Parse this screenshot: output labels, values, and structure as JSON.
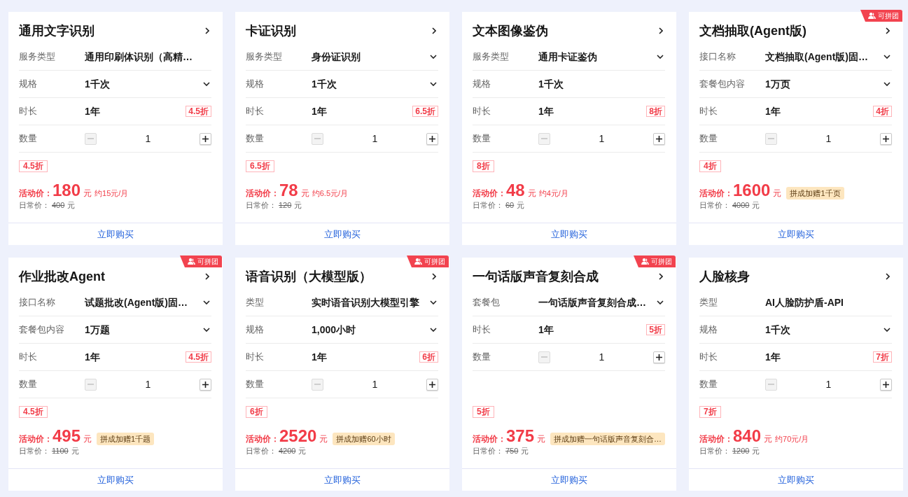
{
  "cards": [
    {
      "title": "通用文字识别",
      "options": [
        {
          "kind": "text",
          "label": "服务类型",
          "value": "通用印刷体识别（高精…"
        },
        {
          "kind": "select",
          "label": "规格",
          "value": "1千次"
        },
        {
          "kind": "duration",
          "label": "时长",
          "value": "1年",
          "discount": "4.5折"
        },
        {
          "kind": "quantity",
          "label": "数量",
          "value": "1",
          "minus_disabled": true
        }
      ],
      "discount": "4.5折",
      "sale_label": "活动价：",
      "price": "180",
      "price_unit": "元",
      "note": {
        "kind": "monthly",
        "text": "约15元/月"
      },
      "regular_label": "日常价：",
      "regular_price": "400",
      "regular_unit": "元",
      "buy": "立即购买"
    },
    {
      "title": "卡证识别",
      "options": [
        {
          "kind": "select",
          "label": "服务类型",
          "value": "身份证识别"
        },
        {
          "kind": "select",
          "label": "规格",
          "value": "1千次"
        },
        {
          "kind": "duration",
          "label": "时长",
          "value": "1年",
          "discount": "6.5折"
        },
        {
          "kind": "quantity",
          "label": "数量",
          "value": "1",
          "minus_disabled": true
        }
      ],
      "discount": "6.5折",
      "sale_label": "活动价：",
      "price": "78",
      "price_unit": "元",
      "note": {
        "kind": "monthly",
        "text": "约6.5元/月"
      },
      "regular_label": "日常价：",
      "regular_price": "120",
      "regular_unit": "元",
      "buy": "立即购买"
    },
    {
      "title": "文本图像鉴伪",
      "options": [
        {
          "kind": "select",
          "label": "服务类型",
          "value": "通用卡证鉴伪"
        },
        {
          "kind": "text",
          "label": "规格",
          "value": "1千次"
        },
        {
          "kind": "duration",
          "label": "时长",
          "value": "1年",
          "discount": "8折"
        },
        {
          "kind": "quantity",
          "label": "数量",
          "value": "1",
          "minus_disabled": true
        }
      ],
      "discount": "8折",
      "sale_label": "活动价：",
      "price": "48",
      "price_unit": "元",
      "note": {
        "kind": "monthly",
        "text": "约4元/月"
      },
      "regular_label": "日常价：",
      "regular_price": "60",
      "regular_unit": "元",
      "buy": "立即购买"
    },
    {
      "title": "文档抽取(Agent版)",
      "badge": "可拼团",
      "options": [
        {
          "kind": "select",
          "label": "接口名称",
          "value": "文档抽取(Agent版)固…"
        },
        {
          "kind": "select",
          "label": "套餐包内容",
          "value": "1万页"
        },
        {
          "kind": "duration",
          "label": "时长",
          "value": "1年",
          "discount": "4折"
        },
        {
          "kind": "quantity",
          "label": "数量",
          "value": "1",
          "minus_disabled": true
        }
      ],
      "discount": "4折",
      "sale_label": "活动价：",
      "price": "1600",
      "price_unit": "元",
      "note": {
        "kind": "promo",
        "text": "拼成加赠1千页"
      },
      "regular_label": "日常价：",
      "regular_price": "4000",
      "regular_unit": "元",
      "buy": "立即购买"
    },
    {
      "title": "作业批改Agent",
      "badge": "可拼团",
      "options": [
        {
          "kind": "select",
          "label": "接口名称",
          "value": "试题批改(Agent版)固…"
        },
        {
          "kind": "select",
          "label": "套餐包内容",
          "value": "1万题"
        },
        {
          "kind": "duration",
          "label": "时长",
          "value": "1年",
          "discount": "4.5折"
        },
        {
          "kind": "quantity",
          "label": "数量",
          "value": "1",
          "minus_disabled": true
        }
      ],
      "discount": "4.5折",
      "sale_label": "活动价：",
      "price": "495",
      "price_unit": "元",
      "note": {
        "kind": "promo",
        "text": "拼成加赠1千题"
      },
      "regular_label": "日常价：",
      "regular_price": "1100",
      "regular_unit": "元",
      "buy": "立即购买"
    },
    {
      "title": "语音识别（大模型版）",
      "badge": "可拼团",
      "options": [
        {
          "kind": "select",
          "label": "类型",
          "value": "实时语音识别大模型引擎"
        },
        {
          "kind": "select",
          "label": "规格",
          "value": "1,000小时"
        },
        {
          "kind": "duration",
          "label": "时长",
          "value": "1年",
          "discount": "6折"
        },
        {
          "kind": "quantity",
          "label": "数量",
          "value": "1",
          "minus_disabled": true
        }
      ],
      "discount": "6折",
      "sale_label": "活动价：",
      "price": "2520",
      "price_unit": "元",
      "note": {
        "kind": "promo",
        "text": "拼成加赠60小时"
      },
      "regular_label": "日常价：",
      "regular_price": "4200",
      "regular_unit": "元",
      "buy": "立即购买"
    },
    {
      "title": "一句话版声音复刻合成",
      "badge": "可拼团",
      "options": [
        {
          "kind": "select",
          "label": "套餐包",
          "value": "一句话版声音复刻合成…"
        },
        {
          "kind": "duration",
          "label": "时长",
          "value": "1年",
          "discount": "5折"
        },
        {
          "kind": "quantity",
          "label": "数量",
          "value": "1",
          "minus_disabled": true
        }
      ],
      "discount": "5折",
      "sale_label": "活动价：",
      "price": "375",
      "price_unit": "元",
      "note": {
        "kind": "promo",
        "text": "拼成加赠一句话版声音复刻合…"
      },
      "regular_label": "日常价：",
      "regular_price": "750",
      "regular_unit": "元",
      "buy": "立即购买"
    },
    {
      "title": "人脸核身",
      "options": [
        {
          "kind": "text",
          "label": "类型",
          "value": "AI人脸防护盾-API"
        },
        {
          "kind": "select",
          "label": "规格",
          "value": "1千次"
        },
        {
          "kind": "duration",
          "label": "时长",
          "value": "1年",
          "discount": "7折"
        },
        {
          "kind": "quantity",
          "label": "数量",
          "value": "1",
          "minus_disabled": true
        }
      ],
      "discount": "7折",
      "sale_label": "活动价：",
      "price": "840",
      "price_unit": "元",
      "note": {
        "kind": "monthly",
        "text": "约70元/月"
      },
      "regular_label": "日常价：",
      "regular_price": "1200",
      "regular_unit": "元",
      "buy": "立即购买"
    }
  ]
}
